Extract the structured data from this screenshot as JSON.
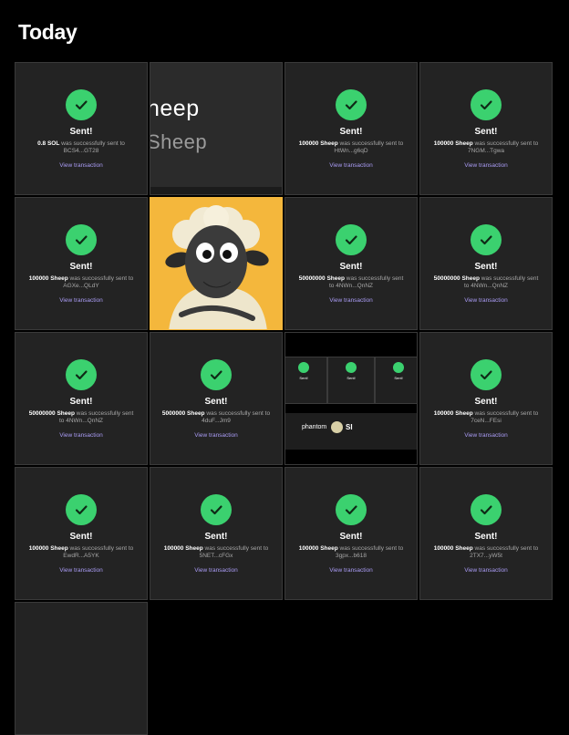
{
  "header": {
    "title": "Today"
  },
  "colors": {
    "background": "#000000",
    "tile": "#232323",
    "check": "#3bd16f",
    "link": "#aa9cf5"
  },
  "common": {
    "sent_label": "Sent!",
    "link_label": "View transaction",
    "was_sent": "was successfully sent to"
  },
  "tiles": [
    {
      "type": "sent",
      "amount": "0.8 SOL",
      "to": "BCS4...GT28"
    },
    {
      "type": "image",
      "name": "cropped-text"
    },
    {
      "type": "sent",
      "amount": "100000 Sheep",
      "to": "HtWn...g6qD"
    },
    {
      "type": "sent",
      "amount": "100000 Sheep",
      "to": "7NGM...Tgwa"
    },
    {
      "type": "sent",
      "amount": "100000 Sheep",
      "to": "AGXe...QLdY"
    },
    {
      "type": "image",
      "name": "sheep-illustration"
    },
    {
      "type": "sent",
      "amount": "50000000 Sheep",
      "to": "4NWn...QnNZ"
    },
    {
      "type": "sent",
      "amount": "50000000 Sheep",
      "to": "4NWn...QnNZ"
    },
    {
      "type": "sent",
      "amount": "50000000 Sheep",
      "to": "4NWn...QnNZ"
    },
    {
      "type": "sent",
      "amount": "5000000 Sheep",
      "to": "4duF...Jm9"
    },
    {
      "type": "image",
      "name": "mini-screenshot"
    },
    {
      "type": "sent",
      "amount": "100000 Sheep",
      "to": "7ceN...FEsi"
    },
    {
      "type": "sent",
      "amount": "100000 Sheep",
      "to": "EwdR...A5YK"
    },
    {
      "type": "sent",
      "amount": "100000 Sheep",
      "to": "5NET...cFGx"
    },
    {
      "type": "sent",
      "amount": "100000 Sheep",
      "to": "3gpx...b618"
    },
    {
      "type": "sent",
      "amount": "100000 Sheep",
      "to": "2TX7...yW5t"
    },
    {
      "type": "sent",
      "amount": "",
      "to": ""
    }
  ],
  "crop_image": {
    "line1": "heep",
    "line2": "Sheep"
  },
  "mini_screenshot": {
    "label": "Sent!",
    "brand": "phantom",
    "brand_suffix": "SI"
  }
}
